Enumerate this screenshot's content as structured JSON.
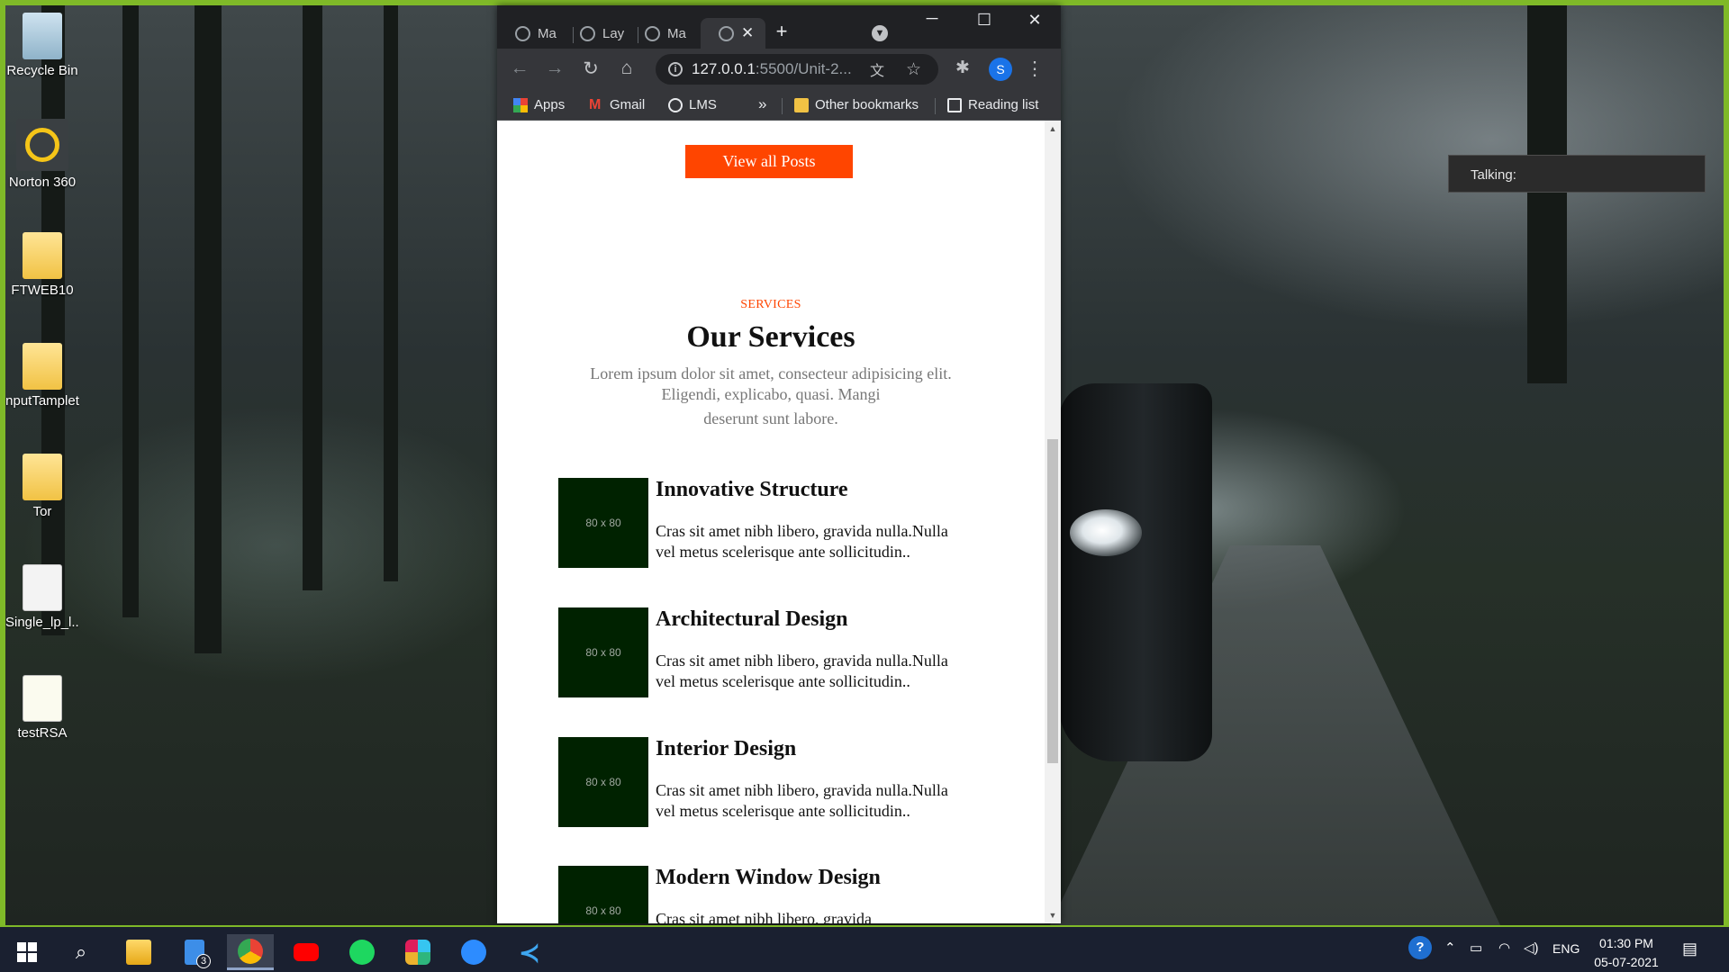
{
  "desktop": {
    "icons": [
      {
        "label": "Recycle Bin",
        "icon": "recycle-bin-icon"
      },
      {
        "label": "Norton 360",
        "icon": "norton-icon"
      },
      {
        "label": "FTWEB10",
        "icon": "folder-icon"
      },
      {
        "label": "nputTamplet",
        "icon": "folder-icon"
      },
      {
        "label": "Tor",
        "icon": "folder-icon"
      },
      {
        "label": "Single_lp_l...",
        "icon": "file-icon"
      },
      {
        "label": "testRSA",
        "icon": "script-icon"
      }
    ]
  },
  "talking_overlay": {
    "label": "Talking:"
  },
  "browser": {
    "tabs": [
      {
        "label": "Ma",
        "active": false
      },
      {
        "label": "Lay",
        "active": false
      },
      {
        "label": "Ma",
        "active": false
      },
      {
        "label": "",
        "active": true
      }
    ],
    "address": {
      "host": "127.0.0.1",
      "path": ":5500/Unit-2..."
    },
    "profile_initial": "S",
    "bookmarks": [
      {
        "label": "Apps",
        "icon": "apps-grid-icon"
      },
      {
        "label": "Gmail",
        "icon": "gmail-icon"
      },
      {
        "label": "LMS",
        "icon": "globe-icon"
      }
    ],
    "overflow_label": "»",
    "other_bookmarks": "Other bookmarks",
    "reading_list": "Reading list"
  },
  "page": {
    "view_all_button": "View all Posts",
    "services": {
      "eyebrow": "SERVICES",
      "title": "Our Services",
      "description_line1": "Lorem ipsum dolor sit amet, consecteur adipisicing elit.",
      "description_line2": "Eligendi, explicabo, quasi. Mangi",
      "description_line3": "deserunt sunt labore.",
      "items": [
        {
          "title": "Innovative Structure",
          "placeholder": "80 x 80",
          "text": "Cras sit amet nibh libero, gravida nulla.Nulla vel metus scelerisque ante sollicitudin.."
        },
        {
          "title": "Architectural Design",
          "placeholder": "80 x 80",
          "text": "Cras sit amet nibh libero, gravida nulla.Nulla vel metus scelerisque ante sollicitudin.."
        },
        {
          "title": "Interior Design",
          "placeholder": "80 x 80",
          "text": "Cras sit amet nibh libero, gravida nulla.Nulla vel metus scelerisque ante sollicitudin.."
        },
        {
          "title": "Modern Window Design",
          "placeholder": "80 x 80",
          "text": "Cras sit amet nibh libero, gravida"
        }
      ]
    }
  },
  "taskbar": {
    "apps": [
      {
        "name": "file-explorer",
        "badge": ""
      },
      {
        "name": "task-view",
        "badge": "3"
      },
      {
        "name": "chrome",
        "badge": ""
      },
      {
        "name": "youtube",
        "badge": ""
      },
      {
        "name": "spotify",
        "badge": ""
      },
      {
        "name": "slack",
        "badge": ""
      },
      {
        "name": "zoom",
        "badge": ""
      },
      {
        "name": "vscode",
        "badge": ""
      }
    ],
    "language": "ENG",
    "time": "01:30 PM",
    "date": "05-07-2021"
  },
  "colors": {
    "accent": "#ff4500",
    "thumbnail": "#002200",
    "border": "#7fb928"
  }
}
